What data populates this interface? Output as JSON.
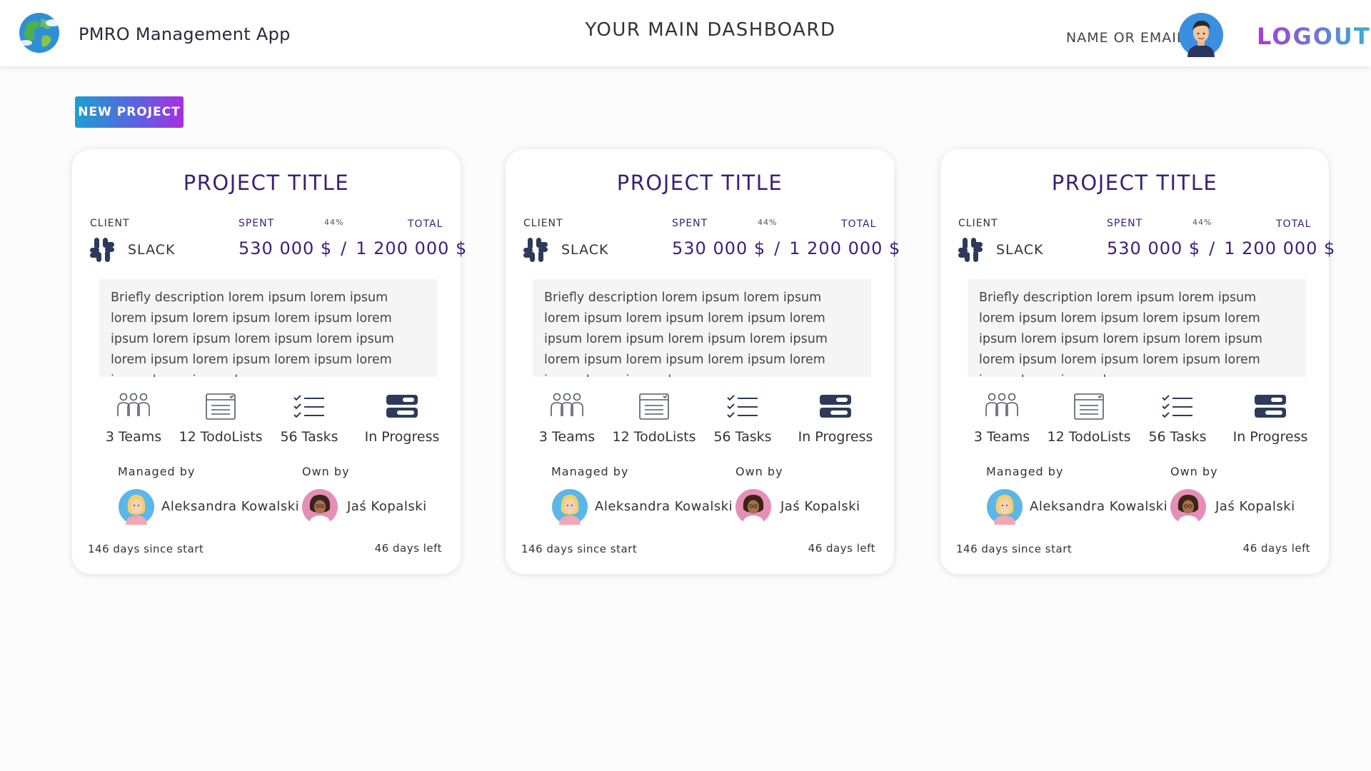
{
  "header": {
    "app_name": "PMRO Management App",
    "dashboard_title": "YOUR MAIN DASHBOARD",
    "user_label": "NAME OR EMAIL",
    "logout_label": "LOGOUT"
  },
  "toolbar": {
    "new_project_label": "NEW PROJECT"
  },
  "colors": {
    "accent_purple": "#3c1f78",
    "logout_gradient": [
      "#a93ad9",
      "#3ab0cf"
    ],
    "button_gradient": [
      "#1e9ed0",
      "#5a64e0",
      "#a72ee0"
    ],
    "icon_navy": "#2d3a5a"
  },
  "icons": {
    "logo": "globe-icon",
    "client": "slack-icon",
    "teams": "teams-icon",
    "todolists": "todolist-icon",
    "tasks": "tasks-icon",
    "status": "progress-icon"
  },
  "projects": [
    {
      "title": "PROJECT TITLE",
      "client_label": "CLIENT",
      "client_name": "SLACK",
      "spent_label": "SPENT",
      "percent": "44%",
      "total_label": "TOTAL",
      "spent": "530 000 $",
      "separator": "/",
      "total": "1 200 000 $",
      "description": "Briefly description lorem ipsum lorem ipsum  lorem ipsum lorem ipsum  lorem ipsum lorem ipsum lorem ipsum lorem ipsum lorem ipsum lorem ipsum lorem ipsum lorem ipsum lorem ipsum lorem ipsum lorem",
      "teams": "3 Teams",
      "todolists": "12 TodoLists",
      "tasks": "56 Tasks",
      "status": "In Progress",
      "managed_label": "Managed by",
      "manager": "Aleksandra Kowalski",
      "owned_label": "Own by",
      "owner": "Jaś Kopalski",
      "since_start": "146 days since start",
      "days_left": "46 days left"
    },
    {
      "title": "PROJECT TITLE",
      "client_label": "CLIENT",
      "client_name": "SLACK",
      "spent_label": "SPENT",
      "percent": "44%",
      "total_label": "TOTAL",
      "spent": "530 000 $",
      "separator": "/",
      "total": "1 200 000 $",
      "description": "Briefly description lorem ipsum lorem ipsum  lorem ipsum lorem ipsum  lorem ipsum lorem ipsum lorem ipsum lorem ipsum lorem ipsum lorem ipsum lorem ipsum lorem ipsum lorem ipsum lorem ipsum lorem",
      "teams": "3 Teams",
      "todolists": "12 TodoLists",
      "tasks": "56 Tasks",
      "status": "In Progress",
      "managed_label": "Managed by",
      "manager": "Aleksandra Kowalski",
      "owned_label": "Own by",
      "owner": "Jaś Kopalski",
      "since_start": "146 days since start",
      "days_left": "46 days left"
    },
    {
      "title": "PROJECT TITLE",
      "client_label": "CLIENT",
      "client_name": "SLACK",
      "spent_label": "SPENT",
      "percent": "44%",
      "total_label": "TOTAL",
      "spent": "530 000 $",
      "separator": "/",
      "total": "1 200 000 $",
      "description": "Briefly description lorem ipsum lorem ipsum  lorem ipsum lorem ipsum  lorem ipsum lorem ipsum lorem ipsum lorem ipsum lorem ipsum lorem ipsum lorem ipsum lorem ipsum lorem ipsum lorem ipsum lorem",
      "teams": "3 Teams",
      "todolists": "12 TodoLists",
      "tasks": "56 Tasks",
      "status": "In Progress",
      "managed_label": "Managed by",
      "manager": "Aleksandra Kowalski",
      "owned_label": "Own by",
      "owner": "Jaś Kopalski",
      "since_start": "146 days since start",
      "days_left": "46 days left"
    }
  ]
}
